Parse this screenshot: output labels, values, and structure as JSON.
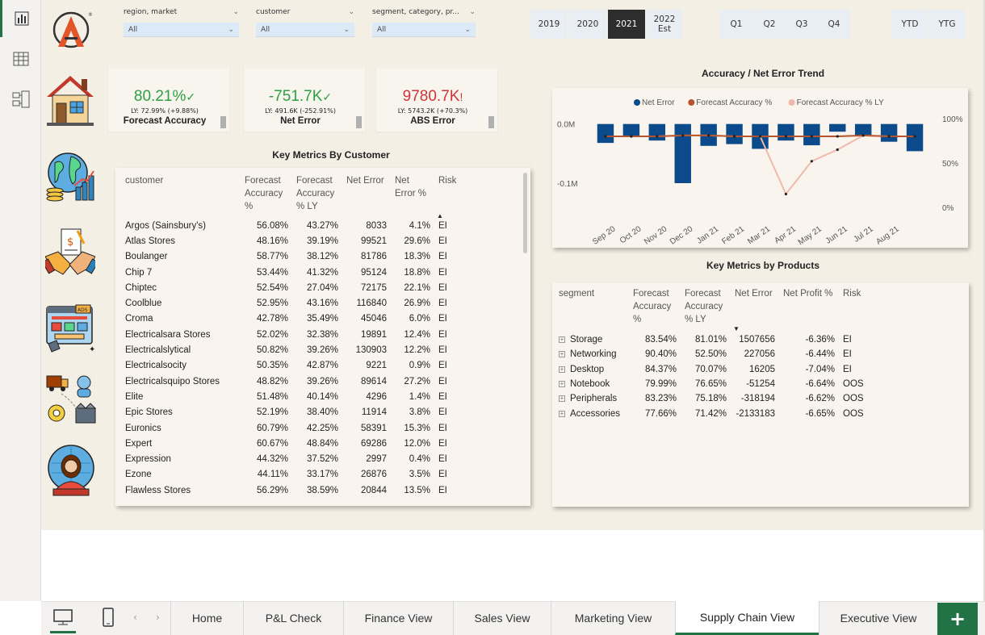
{
  "filters": {
    "region": {
      "label": "region, market",
      "value": "All"
    },
    "customer": {
      "label": "customer",
      "value": "All"
    },
    "segment": {
      "label": "segment, category, pr...",
      "value": "All"
    }
  },
  "years": [
    "2019",
    "2020",
    "2021",
    "2022"
  ],
  "year_2022_sub": "Est",
  "selected_year": "2021",
  "quarters": [
    "Q1",
    "Q2",
    "Q3",
    "Q4"
  ],
  "periods": [
    "YTD",
    "YTG"
  ],
  "kpis": [
    {
      "value": "80.21%",
      "mark": "✓",
      "ly": "LY: 72.99% (+9.88%)",
      "title": "Forecast Accuracy",
      "color": "#2ea043"
    },
    {
      "value": "-751.7K",
      "mark": "✓",
      "ly": "LY: 491.6K (-252.91%)",
      "title": "Net Error",
      "color": "#2ea043"
    },
    {
      "value": "9780.7K",
      "mark": "!",
      "ly": "LY: 5743.2K (+70.3%)",
      "title": "ABS Error",
      "color": "#d13438"
    }
  ],
  "customer_table": {
    "title": "Key Metrics By Customer",
    "headers": [
      "customer",
      "Forecast Accuracy %",
      "Forecast Accuracy % LY",
      "Net Error",
      "Net Error %",
      "Risk"
    ],
    "rows": [
      [
        "Argos (Sainsbury's)",
        "56.08%",
        "43.27%",
        "8033",
        "4.1%",
        "EI"
      ],
      [
        "Atlas Stores",
        "48.16%",
        "39.19%",
        "99521",
        "29.6%",
        "EI"
      ],
      [
        "Boulanger",
        "58.77%",
        "38.12%",
        "81786",
        "18.3%",
        "EI"
      ],
      [
        "Chip 7",
        "53.44%",
        "41.32%",
        "95124",
        "18.8%",
        "EI"
      ],
      [
        "Chiptec",
        "52.54%",
        "27.04%",
        "72175",
        "22.1%",
        "EI"
      ],
      [
        "Coolblue",
        "52.95%",
        "43.16%",
        "116840",
        "26.9%",
        "EI"
      ],
      [
        "Croma",
        "42.78%",
        "35.49%",
        "45046",
        "6.0%",
        "EI"
      ],
      [
        "Electricalsara Stores",
        "52.02%",
        "32.38%",
        "19891",
        "12.4%",
        "EI"
      ],
      [
        "Electricalslytical",
        "50.82%",
        "39.26%",
        "130903",
        "12.2%",
        "EI"
      ],
      [
        "Electricalsocity",
        "50.35%",
        "42.87%",
        "9221",
        "0.9%",
        "EI"
      ],
      [
        "Electricalsquipo Stores",
        "48.82%",
        "39.26%",
        "89614",
        "27.2%",
        "EI"
      ],
      [
        "Elite",
        "51.48%",
        "40.14%",
        "4296",
        "1.4%",
        "EI"
      ],
      [
        "Epic Stores",
        "52.19%",
        "38.40%",
        "11914",
        "3.8%",
        "EI"
      ],
      [
        "Euronics",
        "60.79%",
        "42.25%",
        "58391",
        "15.3%",
        "EI"
      ],
      [
        "Expert",
        "60.67%",
        "48.84%",
        "69286",
        "12.0%",
        "EI"
      ],
      [
        "Expression",
        "44.32%",
        "37.52%",
        "2997",
        "0.4%",
        "EI"
      ],
      [
        "Ezone",
        "44.11%",
        "33.17%",
        "26876",
        "3.5%",
        "EI"
      ],
      [
        "Flawless Stores",
        "56.29%",
        "38.59%",
        "20844",
        "13.5%",
        "EI"
      ]
    ]
  },
  "product_table": {
    "title": "Key Metrics by Products",
    "headers": [
      "segment",
      "Forecast Accuracy %",
      "Forecast Accuracy % LY",
      "Net Error",
      "Net Profit %",
      "Risk"
    ],
    "rows": [
      [
        "Storage",
        "83.54%",
        "81.01%",
        "1507656",
        "-6.36%",
        "EI"
      ],
      [
        "Networking",
        "90.40%",
        "52.50%",
        "227056",
        "-6.44%",
        "EI"
      ],
      [
        "Desktop",
        "84.37%",
        "70.07%",
        "16205",
        "-7.04%",
        "EI"
      ],
      [
        "Notebook",
        "79.99%",
        "76.65%",
        "-51254",
        "-6.64%",
        "OOS"
      ],
      [
        "Peripherals",
        "83.23%",
        "75.18%",
        "-318194",
        "-6.62%",
        "OOS"
      ],
      [
        "Accessories",
        "77.66%",
        "71.42%",
        "-2133183",
        "-6.65%",
        "OOS"
      ]
    ]
  },
  "chart_data": {
    "type": "bar",
    "title": "Accuracy / Net Error Trend",
    "categories": [
      "Sep 20",
      "Oct 20",
      "Nov 20",
      "Dec 20",
      "Jan 21",
      "Feb 21",
      "Mar 21",
      "Apr 21",
      "May 21",
      "Jun 21",
      "Jul 21",
      "Aug 21"
    ],
    "series": [
      {
        "name": "Net Error",
        "kind": "bar",
        "axis": "left",
        "color": "#0b4a8b",
        "values": [
          -0.032,
          -0.022,
          -0.028,
          -0.1,
          -0.037,
          -0.034,
          -0.042,
          -0.028,
          -0.036,
          -0.013,
          -0.02,
          -0.03,
          -0.046
        ]
      },
      {
        "name": "Forecast Accuracy %",
        "kind": "line",
        "axis": "right",
        "color": "#b5532c",
        "values": [
          80,
          80,
          80,
          81,
          81,
          80,
          80,
          80,
          80,
          80,
          81,
          80,
          80
        ]
      },
      {
        "name": "Forecast Accuracy % LY",
        "kind": "line",
        "axis": "right",
        "color": "#f0b8a8",
        "values": [
          80,
          80,
          80,
          81,
          81,
          80,
          80,
          15,
          52,
          65,
          81,
          80,
          80
        ]
      }
    ],
    "left_axis": {
      "ticks": [
        "0.0M",
        "-0.1M"
      ],
      "range": [
        -0.13,
        0.02
      ]
    },
    "right_axis": {
      "ticks": [
        "100%",
        "50%",
        "0%"
      ],
      "range": [
        0,
        100
      ]
    },
    "legend": "top"
  },
  "page_tabs": [
    "Home",
    "P&L Check",
    "Finance View",
    "Sales View",
    "Marketing View",
    "Supply Chain View",
    "Executive View"
  ],
  "selected_tab": "Supply Chain View",
  "add_label": "+"
}
